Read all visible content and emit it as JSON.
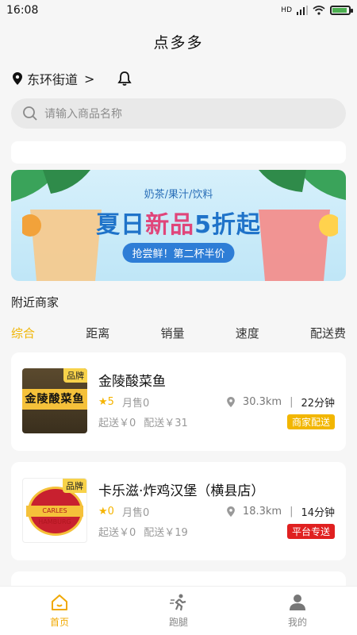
{
  "status": {
    "time": "16:08",
    "network": "HD"
  },
  "app_title": "点多多",
  "location": {
    "label": "东环街道",
    "chevron": ">"
  },
  "search": {
    "placeholder": "请输入商品名称"
  },
  "banner": {
    "subtitle": "奶茶/果汁/饮料",
    "headline_a": "夏日",
    "headline_b": "新品",
    "headline_c": "5折起",
    "cta": "抢尝鲜！第二杯半价"
  },
  "section_title": "附近商家",
  "sort_tabs": [
    {
      "label": "综合",
      "active": true
    },
    {
      "label": "距离",
      "active": false
    },
    {
      "label": "销量",
      "active": false
    },
    {
      "label": "速度",
      "active": false
    },
    {
      "label": "配送费",
      "active": false
    }
  ],
  "merchants": [
    {
      "brand_tag": "品牌",
      "name": "金陵酸菜鱼",
      "thumb_text": "金陵酸菜鱼",
      "rating": "5",
      "monthly_sales": "月售0",
      "distance": "30.3km",
      "separator": "|",
      "time": "22分钟",
      "min_order": "起送￥0",
      "delivery_fee": "配送￥31",
      "badge": "商家配送",
      "badge_color": "#f2b600"
    },
    {
      "brand_tag": "品牌",
      "name": "卡乐滋·炸鸡汉堡（横县店）",
      "thumb_text": "CARLES HAMBURG",
      "rating": "0",
      "monthly_sales": "月售0",
      "distance": "18.3km",
      "separator": "|",
      "time": "14分钟",
      "min_order": "起送￥0",
      "delivery_fee": "配送￥19",
      "badge": "平台专送",
      "badge_color": "#e02020"
    }
  ],
  "tabbar": [
    {
      "label": "首页",
      "icon": "home-icon",
      "active": true
    },
    {
      "label": "跑腿",
      "icon": "runner-icon",
      "active": false
    },
    {
      "label": "我的",
      "icon": "user-icon",
      "active": false
    }
  ],
  "colors": {
    "accent": "#f0b400",
    "background": "#f6f6f6"
  }
}
